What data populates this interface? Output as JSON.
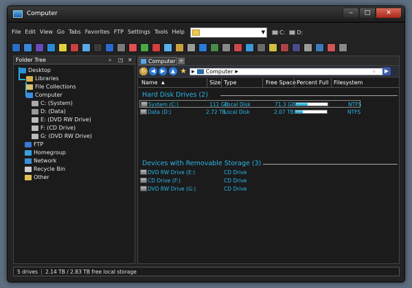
{
  "window": {
    "title": "Computer"
  },
  "menu": [
    "File",
    "Edit",
    "View",
    "Go",
    "Tabs",
    "Favorites",
    "FTP",
    "Settings",
    "Tools",
    "Help"
  ],
  "drives_bar": [
    {
      "label": "C:"
    },
    {
      "label": "D:"
    }
  ],
  "tree": {
    "header": "Folder Tree",
    "nodes": [
      {
        "label": "Desktop",
        "color": "#2d8fd8"
      },
      {
        "label": "Libraries",
        "color": "#d8b24a"
      },
      {
        "label": "File Collections",
        "color": "#d8c070"
      },
      {
        "label": "Computer",
        "color": "#3a8ee0"
      },
      {
        "label": "C: (System)",
        "color": "#aaaaaa"
      },
      {
        "label": "D: (Data)",
        "color": "#999999"
      },
      {
        "label": "E: (DVD RW Drive)",
        "color": "#bbbbbb"
      },
      {
        "label": "F: (CD Drive)",
        "color": "#bbbbbb"
      },
      {
        "label": "G: (DVD RW Drive)",
        "color": "#bbbbbb"
      },
      {
        "label": "FTP",
        "color": "#3a7ad8"
      },
      {
        "label": "Homegroup",
        "color": "#3aa0e0"
      },
      {
        "label": "Network",
        "color": "#3a90d8"
      },
      {
        "label": "Recycle Bin",
        "color": "#cccccc"
      },
      {
        "label": "Other",
        "color": "#e0c050"
      }
    ]
  },
  "tab": {
    "label": "Computer",
    "add": "+"
  },
  "breadcrumb": {
    "label": "Computer",
    "sep": "▶"
  },
  "columns": {
    "name": "Name",
    "size": "Size",
    "type": "Type",
    "free": "Free Space",
    "percent": "Percent Full",
    "fs": "Filesystem"
  },
  "groups": [
    {
      "title": "Hard Disk Drives (2)",
      "rows": [
        {
          "name": "System (C:)",
          "size": "111 GB",
          "type": "Local Disk",
          "free": "71.3 GB",
          "percent_full": 0.36,
          "fs": "NTFS"
        },
        {
          "name": "Data (D:)",
          "size": "2.72 TB",
          "type": "Local Disk",
          "free": "2.07 TB",
          "percent_full": 0.24,
          "fs": "NTFS"
        }
      ]
    },
    {
      "title": "Devices with Removable Storage (3)",
      "rows": [
        {
          "name": "DVD RW Drive (E:)",
          "type": "CD Drive"
        },
        {
          "name": "CD Drive (F:)",
          "type": "CD Drive"
        },
        {
          "name": "DVD RW Drive (G:)",
          "type": "CD Drive"
        }
      ]
    }
  ],
  "status": {
    "count": "5 drives",
    "storage": "2.14 TB / 2.83 TB free local storage"
  }
}
